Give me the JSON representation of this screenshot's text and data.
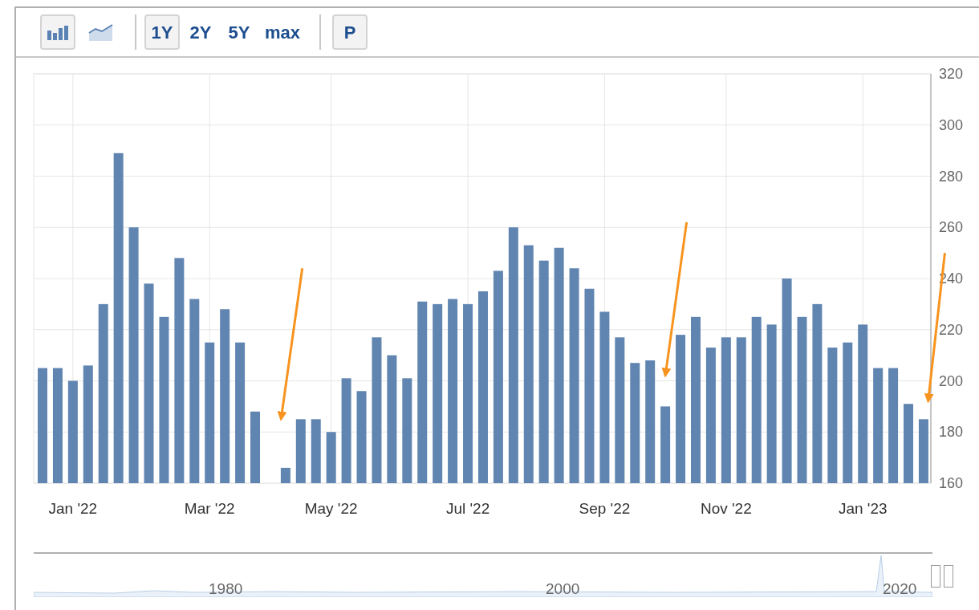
{
  "toolbar": {
    "chart_types": [
      {
        "kind": "bar",
        "selected": true
      },
      {
        "kind": "line",
        "selected": false
      }
    ],
    "ranges": [
      {
        "label": "1Y",
        "selected": true
      },
      {
        "label": "2Y",
        "selected": false
      },
      {
        "label": "5Y",
        "selected": false
      },
      {
        "label": "max",
        "selected": false
      }
    ],
    "extra_button": {
      "label": "P"
    }
  },
  "chart": {
    "chart_data": {
      "type": "bar",
      "categories": [
        null,
        null,
        "Jan '22",
        null,
        null,
        null,
        null,
        null,
        null,
        null,
        null,
        "Mar '22",
        null,
        null,
        null,
        null,
        null,
        null,
        null,
        "May '22",
        null,
        null,
        null,
        null,
        null,
        null,
        null,
        null,
        "Jul '22",
        null,
        null,
        null,
        null,
        null,
        null,
        null,
        null,
        "Sep '22",
        null,
        null,
        null,
        null,
        null,
        null,
        null,
        "Nov '22",
        null,
        null,
        null,
        null,
        null,
        null,
        null,
        null,
        "Jan '23",
        null,
        null,
        null,
        null
      ],
      "series": [
        {
          "color": "#6085b1",
          "values": [
            205,
            205,
            200,
            206,
            230,
            289,
            260,
            238,
            225,
            248,
            232,
            215,
            228,
            215,
            188,
            null,
            166,
            185,
            185,
            180,
            201,
            196,
            217,
            210,
            201,
            231,
            230,
            232,
            230,
            235,
            243,
            260,
            253,
            247,
            252,
            244,
            236,
            227,
            217,
            207,
            208,
            190,
            218,
            225,
            213,
            217,
            217,
            225,
            222,
            240,
            225,
            230,
            213,
            215,
            222,
            205,
            205,
            191,
            185
          ]
        }
      ],
      "ylim": [
        160,
        320
      ],
      "yticks": [
        160,
        180,
        200,
        220,
        240,
        260,
        280,
        300,
        320
      ],
      "grid": true
    }
  },
  "navigator": {
    "labels": [
      "1980",
      "2000",
      "2020"
    ]
  }
}
